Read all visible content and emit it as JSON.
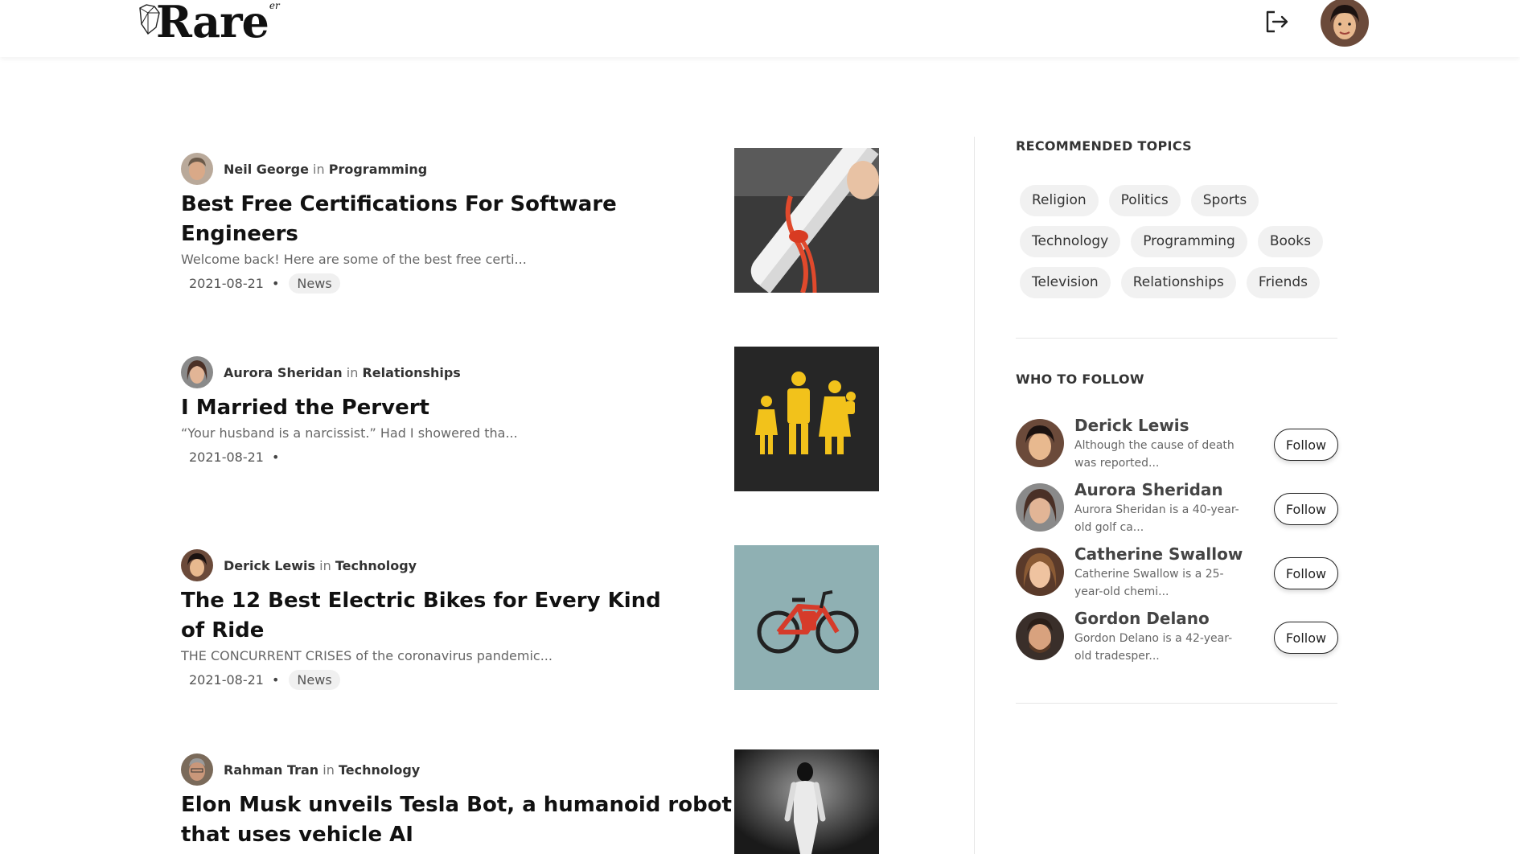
{
  "brand": {
    "logo_text": "Rare",
    "logo_sup": "er"
  },
  "header": {
    "logout_icon": "logout-icon",
    "avatar": "user-avatar"
  },
  "articles": [
    {
      "author": "Neil George",
      "in": "in",
      "topic": "Programming",
      "title": "Best Free Certifications For Software Engineers",
      "excerpt": "Welcome back! Here are some of the best free certi...",
      "date": "2021-08-21",
      "dot": "•",
      "tag": "News"
    },
    {
      "author": "Aurora Sheridan",
      "in": "in",
      "topic": "Relationships",
      "title": "I Married the Pervert",
      "excerpt": "“Your husband is a narcissist.” Had I showered tha...",
      "date": "2021-08-21",
      "dot": "•",
      "tag": ""
    },
    {
      "author": "Derick Lewis",
      "in": "in",
      "topic": "Technology",
      "title": "The 12 Best Electric Bikes for Every Kind of Ride",
      "excerpt": "THE CONCURRENT CRISES of the coronavirus pandemic...",
      "date": "2021-08-21",
      "dot": "•",
      "tag": "News"
    },
    {
      "author": "Rahman Tran",
      "in": "in",
      "topic": "Technology",
      "title": "Elon Musk unveils Tesla Bot, a humanoid robot that uses vehicle AI"
    }
  ],
  "sidebar": {
    "recommended_title": "RECOMMENDED TOPICS",
    "topics": [
      "Religion",
      "Politics",
      "Sports",
      "Technology",
      "Programming",
      "Books",
      "Television",
      "Relationships",
      "Friends"
    ],
    "follow_title": "WHO TO FOLLOW",
    "follow": [
      {
        "name": "Derick Lewis",
        "bio": "Although the cause of death was reported...",
        "button": "Follow"
      },
      {
        "name": "Aurora Sheridan",
        "bio": "Aurora Sheridan is a 40-year-old golf ca...",
        "button": "Follow"
      },
      {
        "name": "Catherine Swallow",
        "bio": "Catherine Swallow is a 25-year-old chemi...",
        "button": "Follow"
      },
      {
        "name": "Gordon Delano",
        "bio": "Gordon Delano is a 42-year-old tradesper...",
        "button": "Follow"
      }
    ]
  }
}
